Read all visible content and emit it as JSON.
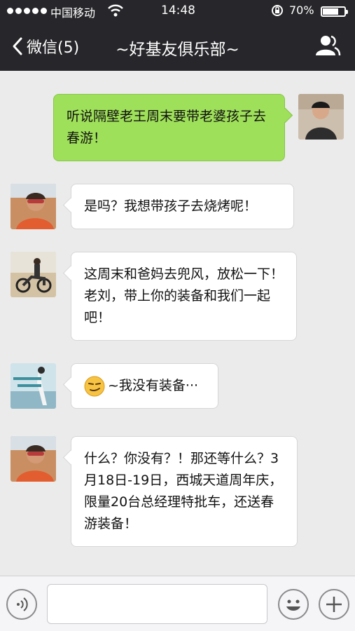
{
  "status_bar": {
    "carrier": "中国移动",
    "time": "14:48",
    "battery_percent": "70%",
    "battery_level": 0.7
  },
  "nav": {
    "back_label": "微信(5)",
    "title": "~好基友俱乐部~"
  },
  "messages": [
    {
      "direction": "out",
      "text": "听说隔壁老王周末要带老婆孩子去春游！"
    },
    {
      "direction": "in",
      "text": "是吗？我想带孩子去烧烤呢！"
    },
    {
      "direction": "in",
      "text": "这周末和爸妈去兜风，放松一下！老刘，带上你的装备和我们一起吧！"
    },
    {
      "direction": "in",
      "emoji": "smirk-emoji",
      "text": "~我没有装备···"
    },
    {
      "direction": "in",
      "text": "什么？你没有？！那还等什么？3月18日-19日，西城天道周年庆，限量20台总经理特批车，还送春游装备！"
    }
  ],
  "input": {
    "value": "",
    "placeholder": ""
  },
  "colors": {
    "nav_background": "#27272b",
    "chat_background": "#ebebeb",
    "outgoing_bubble": "#9fe05a",
    "incoming_bubble": "#ffffff"
  }
}
